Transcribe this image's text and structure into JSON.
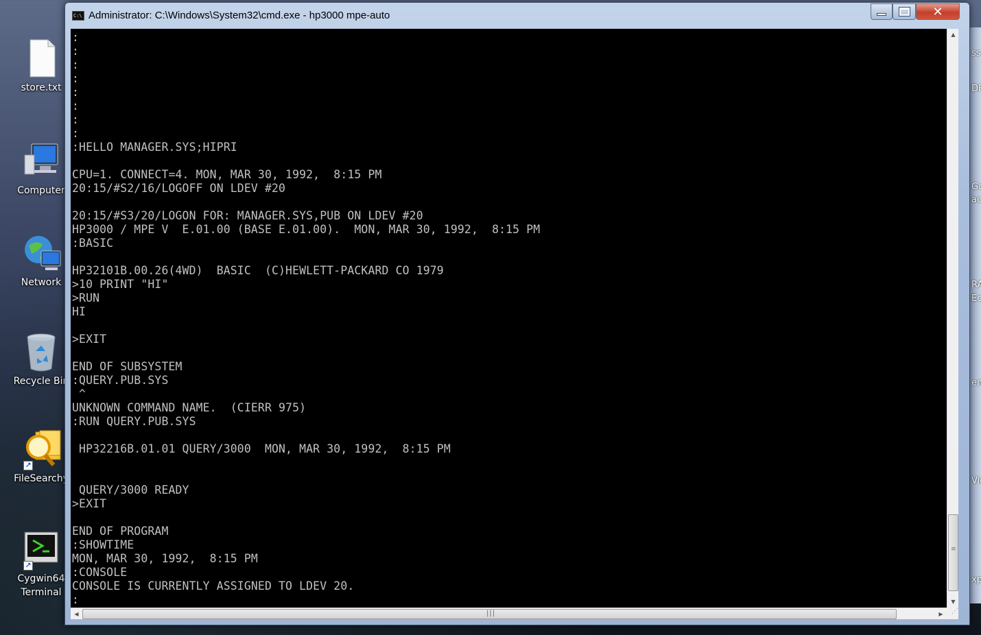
{
  "desktop": {
    "icons": [
      {
        "label": "store.txt",
        "icon": "text-file-icon"
      },
      {
        "label": "Computer",
        "icon": "computer-icon"
      },
      {
        "label": "Network",
        "icon": "network-icon"
      },
      {
        "label": "Recycle Bin",
        "icon": "recycle-bin-icon"
      },
      {
        "label": "FileSearchy",
        "icon": "file-search-icon"
      },
      {
        "label": "Cygwin64\nTerminal",
        "icon": "terminal-icon"
      }
    ],
    "peek_texts": [
      "ss",
      "DF",
      "Go",
      "ack",
      "RA",
      "Ec",
      "en",
      "Vie",
      "xp"
    ]
  },
  "window": {
    "title": "Administrator: C:\\Windows\\System32\\cmd.exe - hp3000  mpe-auto",
    "icon_text": "C:\\",
    "controls": {
      "close_symbol": "✕"
    }
  },
  "console": {
    "lines": [
      ":",
      ":",
      ":",
      ":",
      ":",
      ":",
      ":",
      ":",
      ":HELLO MANAGER.SYS;HIPRI",
      "",
      "CPU=1. CONNECT=4. MON, MAR 30, 1992,  8:15 PM",
      "20:15/#S2/16/LOGOFF ON LDEV #20",
      "",
      "20:15/#S3/20/LOGON FOR: MANAGER.SYS,PUB ON LDEV #20",
      "HP3000 / MPE V  E.01.00 (BASE E.01.00).  MON, MAR 30, 1992,  8:15 PM",
      ":BASIC",
      "",
      "HP32101B.00.26(4WD)  BASIC  (C)HEWLETT-PACKARD CO 1979",
      ">10 PRINT \"HI\"",
      ">RUN",
      "HI",
      "",
      ">EXIT",
      "",
      "END OF SUBSYSTEM",
      ":QUERY.PUB.SYS",
      " ^",
      "UNKNOWN COMMAND NAME.  (CIERR 975)",
      ":RUN QUERY.PUB.SYS",
      "",
      " HP32216B.01.01 QUERY/3000  MON, MAR 30, 1992,  8:15 PM",
      "",
      "",
      " QUERY/3000 READY",
      ">EXIT",
      "",
      "END OF PROGRAM",
      ":SHOWTIME",
      "MON, MAR 30, 1992,  8:15 PM",
      ":CONSOLE",
      "CONSOLE IS CURRENTLY ASSIGNED TO LDEV 20.",
      ":"
    ]
  },
  "scroll": {
    "vertical_position": 0.95,
    "horizontal_position": 0.0
  }
}
